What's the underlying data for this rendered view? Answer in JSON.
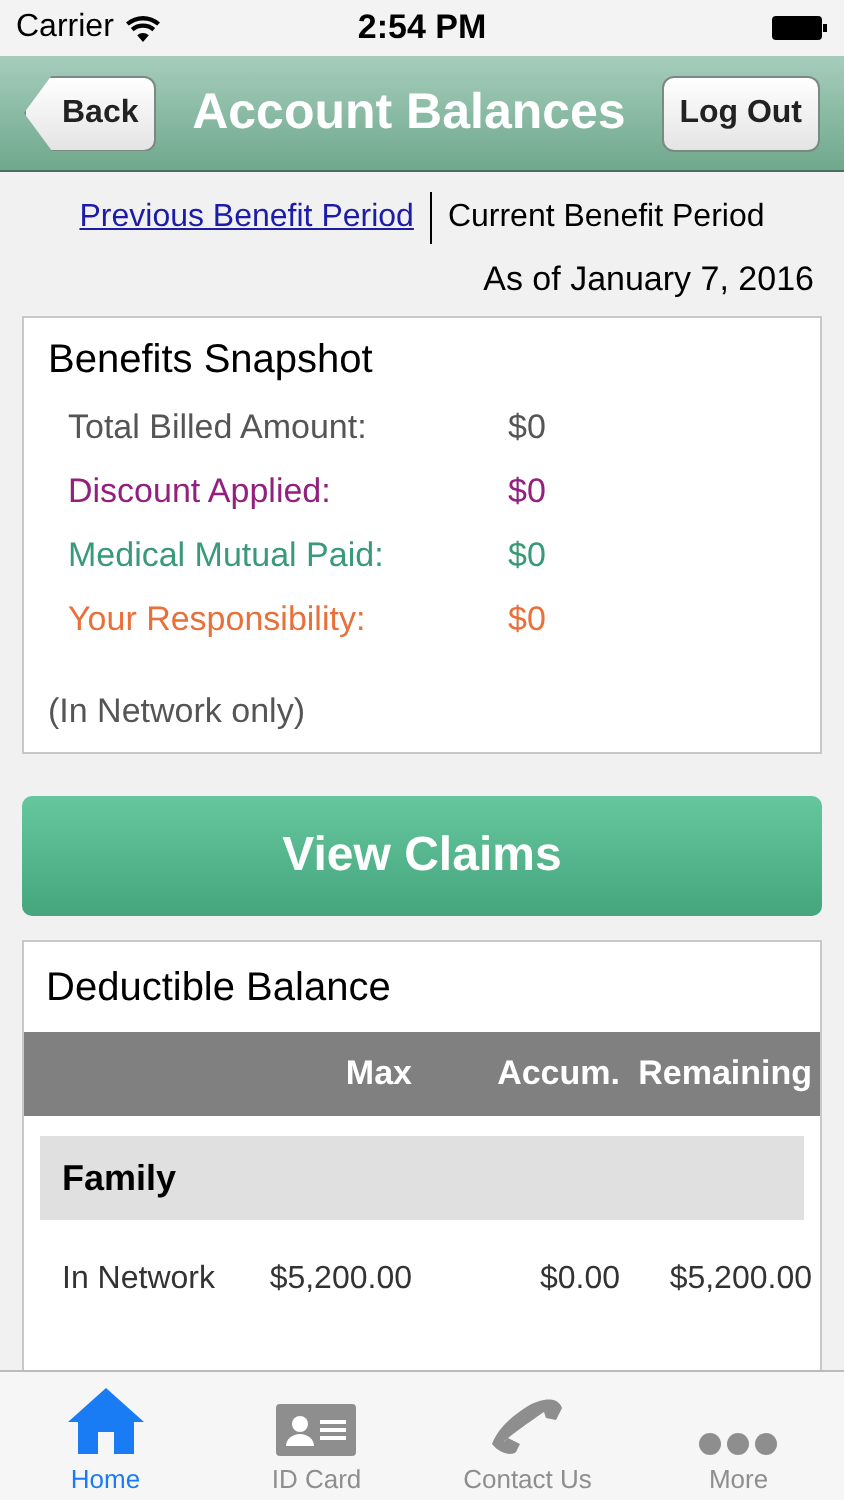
{
  "status_bar": {
    "carrier": "Carrier",
    "time": "2:54 PM"
  },
  "nav_bar": {
    "back": "Back",
    "title": "Account Balances",
    "action": "Log Out"
  },
  "period_tabs": [
    {
      "label": "Previous Benefit Period",
      "selected": false
    },
    {
      "label": "Current Benefit Period",
      "selected": true
    }
  ],
  "as_of": "As of January 7, 2016",
  "snapshot": {
    "title": "Benefits Snapshot",
    "rows": [
      {
        "label": "Total Billed Amount:",
        "value": "$0",
        "color": "#555555"
      },
      {
        "label": "Discount Applied:",
        "value": "$0",
        "color": "#93207e"
      },
      {
        "label": "Medical Mutual Paid:",
        "value": "$0",
        "color": "#3a9a78"
      },
      {
        "label": "Your Responsibility:",
        "value": "$0",
        "color": "#e8703a"
      }
    ],
    "note": "(In Network only)"
  },
  "view_claims": "View Claims",
  "deductible": {
    "title": "Deductible Balance",
    "columns": [
      "Max",
      "Accum.",
      "Remaining"
    ],
    "groups": [
      {
        "name": "Family",
        "rows": [
          {
            "label": "In Network",
            "max": "$5,200.00",
            "accum": "$0.00",
            "remaining": "$5,200.00"
          }
        ]
      }
    ]
  },
  "tab_bar": [
    {
      "label": "Home",
      "kind": "home",
      "selected": true
    },
    {
      "label": "ID Card",
      "kind": "card",
      "selected": false
    },
    {
      "label": "Contact Us",
      "kind": "phone",
      "selected": false
    },
    {
      "label": "More",
      "kind": "more",
      "selected": false
    }
  ]
}
